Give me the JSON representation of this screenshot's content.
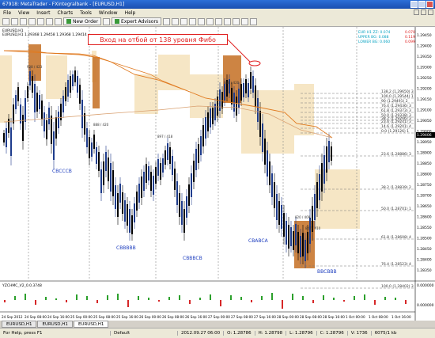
{
  "window": {
    "title": "67918: MetaTrader - FXintegralbank - [EURUSD,H1]"
  },
  "menu": {
    "items": [
      "File",
      "View",
      "Insert",
      "Charts",
      "Tools",
      "Window",
      "Help"
    ]
  },
  "toolbar": {
    "new_order": "New Order",
    "expert_advisors": "Expert Advisors"
  },
  "chart": {
    "symbol_line": "EURUSD,H1",
    "ohlc_line": "EURUSD,H1  1.29368 1.29458 1.29368 1.29414",
    "fibo_legend": [
      "EUR H1 ZZ: 0.074",
      "UPPER BG: 0.088",
      "LOWER BG: 0.060"
    ],
    "fibo_legend_right": [
      "0.070",
      "0.119",
      "0.099"
    ],
    "callout": "Вход на отбой от 138 уровня Фибо",
    "price_ticks": [
      "1.29450",
      "1.29400",
      "1.29350",
      "1.29300",
      "1.29250",
      "1.29200",
      "1.29150",
      "1.29100",
      "1.29050",
      "1.29000",
      "1.28950",
      "1.28900",
      "1.28850",
      "1.28800",
      "1.28750",
      "1.28700",
      "1.28650",
      "1.28600",
      "1.28550",
      "1.28500",
      "1.28450",
      "1.28400",
      "1.28350"
    ],
    "current_price": "1.29406",
    "fibo_levels": [
      "138.2 (1.29650) 3",
      "100.0 (1.29544) 1",
      "90 (1.29491) 2",
      "76.4 (1.29436) 3",
      "61.8 (1.29373) 3",
      "50.0 (1.29338) 3",
      "38.2 (1.29266) 3",
      "23.6 (1.29241) 3",
      "14.6 (1.29201) 4",
      "0.0 (1.29126) 1",
      "23.6 (1.28886) 3",
      "38.2 (1.28839) 2",
      "50.0 (1.28701) 1",
      "61.8 (1.28608) 4",
      "76.4 (1.28523) 4",
      "100.0 (1.28402) 3"
    ],
    "wave_labels": [
      "CBCCCB",
      "CBBBBB",
      "CBBBCB",
      "CBABCA",
      "BBCBBB"
    ],
    "box_labels": [
      "928 / 423",
      "888 / 420",
      "897 / 418",
      "848 / 420",
      "820 / 409",
      "847 / 410"
    ],
    "indicator_label": "YZCHMC_V2_0.0.3748",
    "indicator_ticks": [
      "0.000000",
      "0.000000"
    ],
    "time_ticks": [
      "24 Sep 2012",
      "24 Sep 08:00",
      "24 Sep 16:00",
      "25 Sep 00:00",
      "25 Sep 08:00",
      "25 Sep 16:00",
      "26 Sep 00:00",
      "26 Sep 08:00",
      "26 Sep 16:00",
      "27 Sep 00:00",
      "27 Sep 08:00",
      "27 Sep 16:00",
      "28 Sep 00:00",
      "28 Sep 08:00",
      "28 Sep 16:00",
      "1 Oct 00:00",
      "1 Oct 08:00",
      "1 Oct 16:00"
    ],
    "colors": {
      "bull": "#1e3c8c",
      "bear": "#000000",
      "box_light": "#f3ddb2",
      "box_dark": "#c8772f",
      "line_orange": "#e07a20",
      "accent_red": "#e02020"
    }
  },
  "tabs": [
    "EURUSD,H1",
    "EURUSD,H1",
    "EURUSD,H1"
  ],
  "status": {
    "help": "For Help, press F1",
    "profile": "Default",
    "datetime": "2012.09.27 06:00",
    "open": "O: 1.28786",
    "high": "H: 1.28798",
    "low": "L: 1.28796",
    "close": "C: 1.28796",
    "volume": "V: 1736",
    "connection": "6075/1 kb"
  }
}
